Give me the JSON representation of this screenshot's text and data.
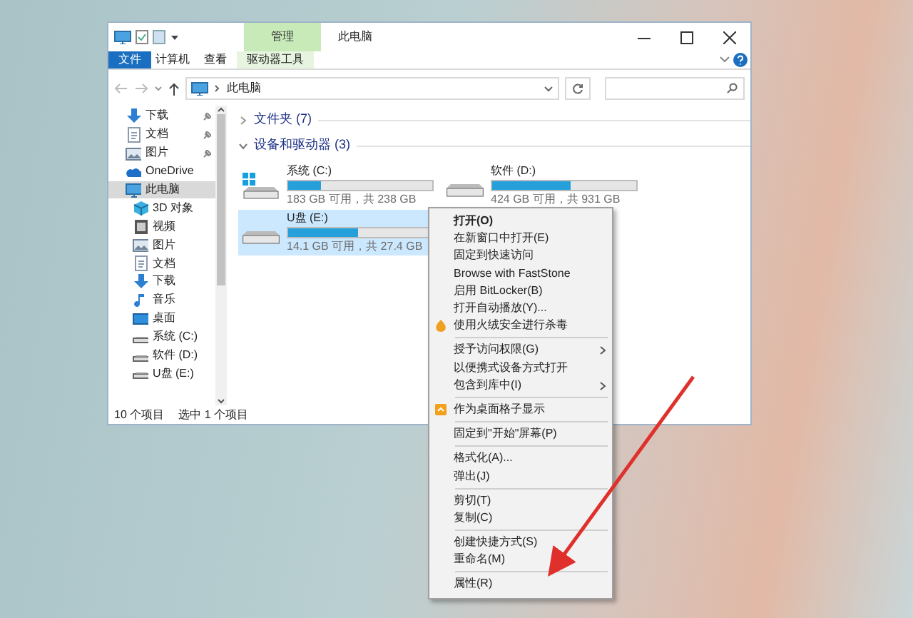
{
  "window": {
    "title": "此电脑",
    "context_tab_group": "管理"
  },
  "ribbon_tabs": [
    {
      "label": "文件",
      "kind": "file"
    },
    {
      "label": "计算机",
      "kind": "normal"
    },
    {
      "label": "查看",
      "kind": "normal"
    },
    {
      "label": "驱动器工具",
      "kind": "context"
    }
  ],
  "address_bar": {
    "path": "此电脑"
  },
  "sidebar": {
    "items": [
      {
        "label": "下载",
        "kind": "download",
        "pinned": true,
        "selected": false
      },
      {
        "label": "文档",
        "kind": "document",
        "pinned": true,
        "selected": false
      },
      {
        "label": "图片",
        "kind": "picture",
        "pinned": true,
        "selected": false
      },
      {
        "label": "OneDrive",
        "kind": "cloud",
        "pinned": false,
        "selected": false
      },
      {
        "label": "此电脑",
        "kind": "computer",
        "pinned": false,
        "selected": true,
        "children": [
          {
            "label": "3D 对象",
            "kind": "cube",
            "pinned": false,
            "selected": false
          },
          {
            "label": "视频",
            "kind": "video",
            "pinned": false,
            "selected": false
          },
          {
            "label": "图片",
            "kind": "picture",
            "pinned": false,
            "selected": false
          },
          {
            "label": "文档",
            "kind": "document",
            "pinned": false,
            "selected": false
          },
          {
            "label": "下载",
            "kind": "download",
            "pinned": false,
            "selected": false
          },
          {
            "label": "音乐",
            "kind": "music",
            "pinned": false,
            "selected": false
          },
          {
            "label": "桌面",
            "kind": "desktop",
            "pinned": false,
            "selected": false
          },
          {
            "label": "系统 (C:)",
            "kind": "drive",
            "pinned": false,
            "selected": false
          },
          {
            "label": "软件 (D:)",
            "kind": "drive",
            "pinned": false,
            "selected": false
          },
          {
            "label": "U盘 (E:)",
            "kind": "drive",
            "pinned": false,
            "selected": false
          }
        ]
      }
    ]
  },
  "sections": [
    {
      "title": "文件夹 (7)",
      "expanded": false
    },
    {
      "title": "设备和驱动器 (3)",
      "expanded": true,
      "drives": [
        {
          "name": "系统 (C:)",
          "kind": "system",
          "level": 0.23,
          "reading": "183 GB 可用，共 238 GB",
          "selected": false
        },
        {
          "name": "软件 (D:)",
          "kind": "disk",
          "level": 0.54,
          "reading": "424 GB 可用，共 931 GB",
          "selected": false
        },
        {
          "name": "U盘 (E:)",
          "kind": "disk",
          "level": 0.49,
          "reading": "14.1 GB 可用，共 27.4 GB",
          "selected": true
        }
      ]
    }
  ],
  "status_bar": {
    "item_count": "10 个项目",
    "selection": "选中 1 个项目"
  },
  "context_menu": {
    "groups": [
      [
        {
          "label": "打开(O)",
          "kind": "default"
        },
        {
          "label": "在新窗口中打开(E)",
          "kind": "plain"
        },
        {
          "label": "固定到快速访问",
          "kind": "plain"
        },
        {
          "label": "Browse with FastStone",
          "kind": "plain"
        },
        {
          "label": "启用 BitLocker(B)",
          "kind": "plain"
        },
        {
          "label": "打开自动播放(Y)...",
          "kind": "plain"
        },
        {
          "label": "使用火绒安全进行杀毒",
          "kind": "shield"
        }
      ],
      [
        {
          "label": "授予访问权限(G)",
          "kind": "submenu"
        },
        {
          "label": "以便携式设备方式打开",
          "kind": "plain"
        },
        {
          "label": "包含到库中(I)",
          "kind": "submenu"
        }
      ],
      [
        {
          "label": "作为桌面格子显示",
          "kind": "grid"
        }
      ],
      [
        {
          "label": "固定到\"开始\"屏幕(P)",
          "kind": "plain"
        }
      ],
      [
        {
          "label": "格式化(A)...",
          "kind": "plain"
        },
        {
          "label": "弹出(J)",
          "kind": "plain"
        }
      ],
      [
        {
          "label": "剪切(T)",
          "kind": "plain"
        },
        {
          "label": "复制(C)",
          "kind": "plain"
        }
      ],
      [
        {
          "label": "创建快捷方式(S)",
          "kind": "plain"
        },
        {
          "label": "重命名(M)",
          "kind": "plain"
        }
      ],
      [
        {
          "label": "属性(R)",
          "kind": "plain",
          "highlighted": true
        }
      ]
    ]
  }
}
